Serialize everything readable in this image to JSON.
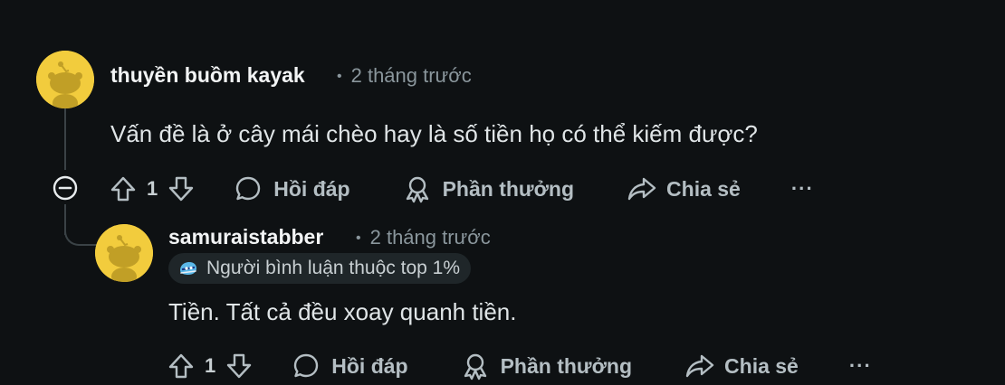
{
  "comments": [
    {
      "username": "thuyền buồm kayak",
      "time": "2 tháng trước",
      "text": "Vấn đề là ở cây mái chèo hay là số tiền họ có thể kiếm được?",
      "votes": "1",
      "reply_label": "Hồi đáp",
      "award_label": "Phần thưởng",
      "share_label": "Chia sẻ",
      "more_label": "···"
    },
    {
      "username": "samuraistabber",
      "time": "2 tháng trước",
      "flair": "Người bình luận thuộc top 1%",
      "text": "Tiền. Tất cả đều xoay quanh tiền.",
      "votes": "1",
      "reply_label": "Hồi đáp",
      "award_label": "Phần thưởng",
      "share_label": "Chia sẻ",
      "more_label": "···"
    }
  ],
  "meta_separator": "•",
  "colors": {
    "background": "#0e1113",
    "avatar": "#f2cc3d",
    "thread_line": "#3a4246",
    "muted_text": "#8a969c",
    "flair_bg": "#1f2629"
  },
  "icons": {
    "avatar": "snoo-avatar-icon",
    "upvote": "upvote-arrow-icon",
    "downvote": "downvote-arrow-icon",
    "reply": "speech-bubble-icon",
    "award": "award-ribbon-icon",
    "share": "share-arrow-icon",
    "collapse": "collapse-minus-icon",
    "flair": "top-commenter-icon"
  }
}
